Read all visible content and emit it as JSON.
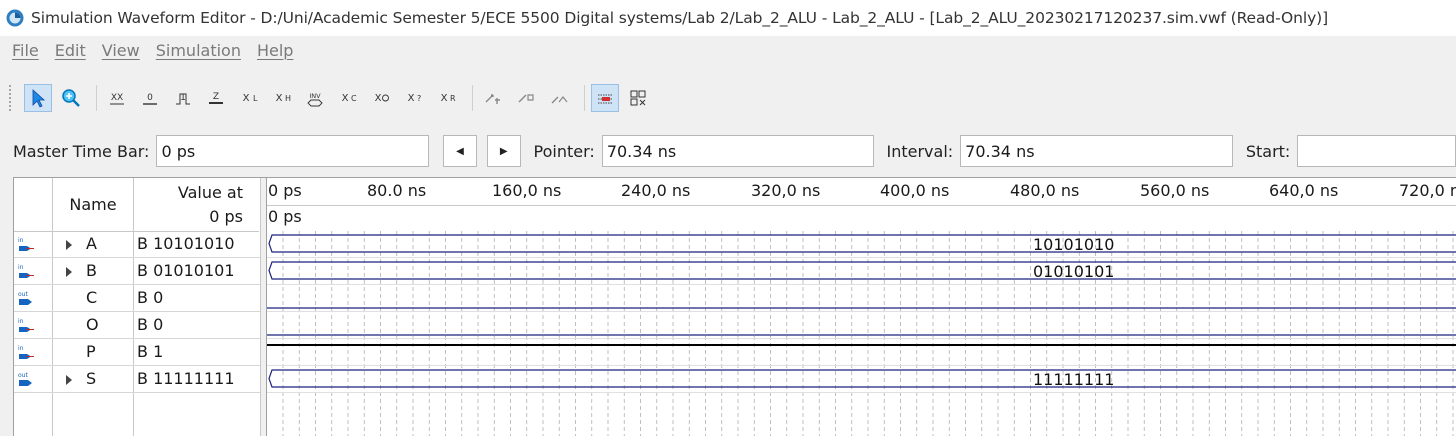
{
  "window": {
    "title": "Simulation Waveform Editor - D:/Uni/Academic Semester 5/ECE 5500 Digital systems/Lab 2/Lab_2_ALU - Lab_2_ALU - [Lab_2_ALU_20230217120237.sim.vwf (Read-Only)]"
  },
  "menu": [
    "File",
    "Edit",
    "View",
    "Simulation",
    "Help"
  ],
  "toolbar": {
    "buttons": [
      "pointer-tool",
      "zoom-tool",
      "forcing-unknown",
      "forcing-low",
      "forcing-high",
      "high-impedance",
      "weak-low",
      "weak-high",
      "invert",
      "count-value",
      "clock",
      "arbitrary-value",
      "random-value",
      "snap-to-grid",
      "sort",
      "find",
      "grid-options",
      "overwrite-clock"
    ]
  },
  "timebar": {
    "master_label": "Master Time Bar:",
    "master_value": "0 ps",
    "prev_symbol": "◀",
    "next_symbol": "▶",
    "pointer_label": "Pointer:",
    "pointer_value": "70.34 ns",
    "interval_label": "Interval:",
    "interval_value": "70.34 ns",
    "start_label": "Start:",
    "start_value": ""
  },
  "table": {
    "name_header": "Name",
    "value_header_line1": "Value at",
    "value_header_line2": "0 ps",
    "rows": [
      {
        "dir": "in",
        "name": "A",
        "value": "B 10101010",
        "bus": true,
        "wave_label": "10101010",
        "level": null
      },
      {
        "dir": "in",
        "name": "B",
        "value": "B 01010101",
        "bus": true,
        "wave_label": "01010101",
        "level": null
      },
      {
        "dir": "out",
        "name": "C",
        "value": "B 0",
        "bus": false,
        "wave_label": "",
        "level": 0
      },
      {
        "dir": "in",
        "name": "O",
        "value": "B 0",
        "bus": false,
        "wave_label": "",
        "level": 0
      },
      {
        "dir": "in",
        "name": "P",
        "value": "B 1",
        "bus": false,
        "wave_label": "",
        "level": 1
      },
      {
        "dir": "out",
        "name": "S",
        "value": "B 11111111",
        "bus": true,
        "wave_label": "11111111",
        "level": null
      }
    ]
  },
  "ruler": {
    "ticks": [
      "0 ps",
      "80.0 ns",
      "160,0 ns",
      "240,0 ns",
      "320,0 ns",
      "400,0 ns",
      "480,0 ns",
      "560,0 ns",
      "640,0 ns",
      "720,0 n"
    ],
    "cursor_label": "0 ps"
  },
  "colors": {
    "wave": "#1a237e",
    "grid": "#b0b0b0"
  }
}
